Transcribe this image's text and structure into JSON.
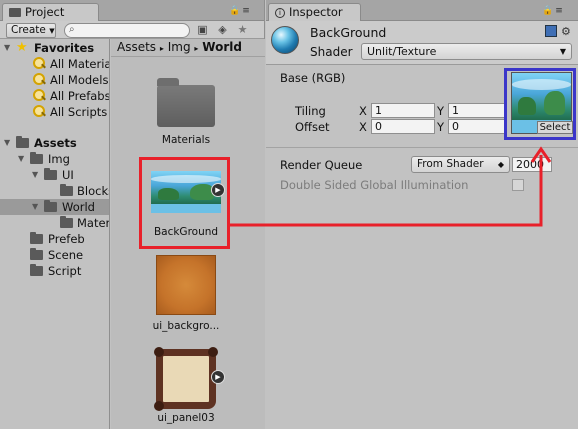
{
  "project": {
    "tab_title": "Project",
    "create_label": "Create",
    "search_placeholder": "",
    "tree": {
      "favorites_label": "Favorites",
      "favorites": [
        "All Materia",
        "All Models",
        "All Prefabs",
        "All Scripts"
      ],
      "assets_label": "Assets",
      "items": [
        {
          "label": "Img",
          "indent": 1
        },
        {
          "label": "UI",
          "indent": 2
        },
        {
          "label": "Blocks",
          "indent": 3
        },
        {
          "label": "World",
          "indent": 2
        },
        {
          "label": "Mater",
          "indent": 3
        },
        {
          "label": "Prefeb",
          "indent": 1
        },
        {
          "label": "Scene",
          "indent": 1
        },
        {
          "label": "Script",
          "indent": 1
        }
      ]
    },
    "breadcrumb": {
      "part1": "Assets",
      "sep1": "▸",
      "part2": "Img",
      "sep2": "▸",
      "current": "World"
    },
    "assets": [
      {
        "label": "Materials",
        "kind": "folder"
      },
      {
        "label": "BackGround",
        "kind": "texture"
      },
      {
        "label": "ui_backgro...",
        "kind": "texture-orange"
      },
      {
        "label": "ui_panel03",
        "kind": "texture-frame"
      }
    ]
  },
  "inspector": {
    "tab_title": "Inspector",
    "material_name": "BackGround",
    "shader_label": "Shader",
    "shader_value": "Unlit/Texture",
    "base_label": "Base (RGB)",
    "tiling_label": "Tiling",
    "offset_label": "Offset",
    "x_label": "X",
    "y_label": "Y",
    "tiling_x": "1",
    "tiling_y": "1",
    "offset_x": "0",
    "offset_y": "0",
    "select_label": "Select",
    "render_queue_label": "Render Queue",
    "render_queue_mode": "From Shader",
    "render_queue_value": "2000",
    "double_sided_label": "Double Sided Global Illumination",
    "double_sided_checked": false
  },
  "colors": {
    "highlight_red": "#e8202a",
    "highlight_blue": "#3b36c9",
    "panel_bg": "#c2c2c2"
  }
}
